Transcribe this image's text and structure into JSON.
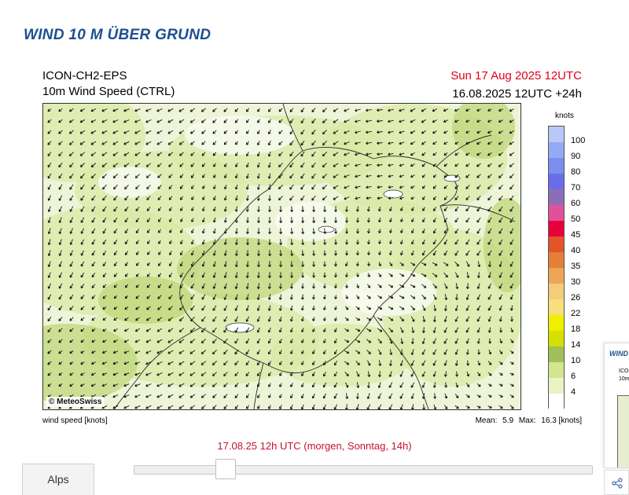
{
  "page": {
    "title": "WIND 10 M ÜBER GRUND"
  },
  "figure": {
    "model": "ICON-CH2-EPS",
    "variable": "10m Wind Speed (CTRL)",
    "valid_time": "Sun 17 Aug 2025 12UTC",
    "run_time": "16.08.2025 12UTC +24h",
    "credit": "© MeteoSwiss",
    "legend_unit": "knots",
    "legend": [
      {
        "label": "100",
        "color": "#b9c8f7"
      },
      {
        "label": "90",
        "color": "#94aaf3"
      },
      {
        "label": "80",
        "color": "#7c8ef0"
      },
      {
        "label": "70",
        "color": "#6a6de8"
      },
      {
        "label": "60",
        "color": "#8c6eb6"
      },
      {
        "label": "50",
        "color": "#e2509c"
      },
      {
        "label": "45",
        "color": "#e8003a"
      },
      {
        "label": "40",
        "color": "#e3542a"
      },
      {
        "label": "35",
        "color": "#e37f38"
      },
      {
        "label": "30",
        "color": "#eda655"
      },
      {
        "label": "26",
        "color": "#f3cc7c"
      },
      {
        "label": "22",
        "color": "#f7e07b"
      },
      {
        "label": "18",
        "color": "#f2ee00"
      },
      {
        "label": "14",
        "color": "#d6e000"
      },
      {
        "label": "10",
        "color": "#9fc05a"
      },
      {
        "label": "6",
        "color": "#d3e58d"
      },
      {
        "label": "4",
        "color": "#eaf2c6"
      },
      {
        "label": "",
        "color": "#ffffff"
      }
    ],
    "footnote_left": "wind speed [knots]",
    "mean_label": "Mean:",
    "mean_value": "5.9",
    "max_label": "Max:",
    "max_value": "16.3 [knots]",
    "colors": {
      "terrain_low": "#eef4d8",
      "terrain_mid": "#d9e9a6",
      "terrain_high": "#bfd77a",
      "border": "#2b2b2b",
      "arrow": "#111111"
    }
  },
  "slider": {
    "caption": "17.08.25 12h UTC (morgen, Sonntag, 14h)",
    "position_fraction": 0.2
  },
  "region_button": {
    "label": "Alps"
  },
  "side_preview": {
    "title": "WIND",
    "line1": "ICO",
    "line2": "10m",
    "icon": "share-icon"
  }
}
